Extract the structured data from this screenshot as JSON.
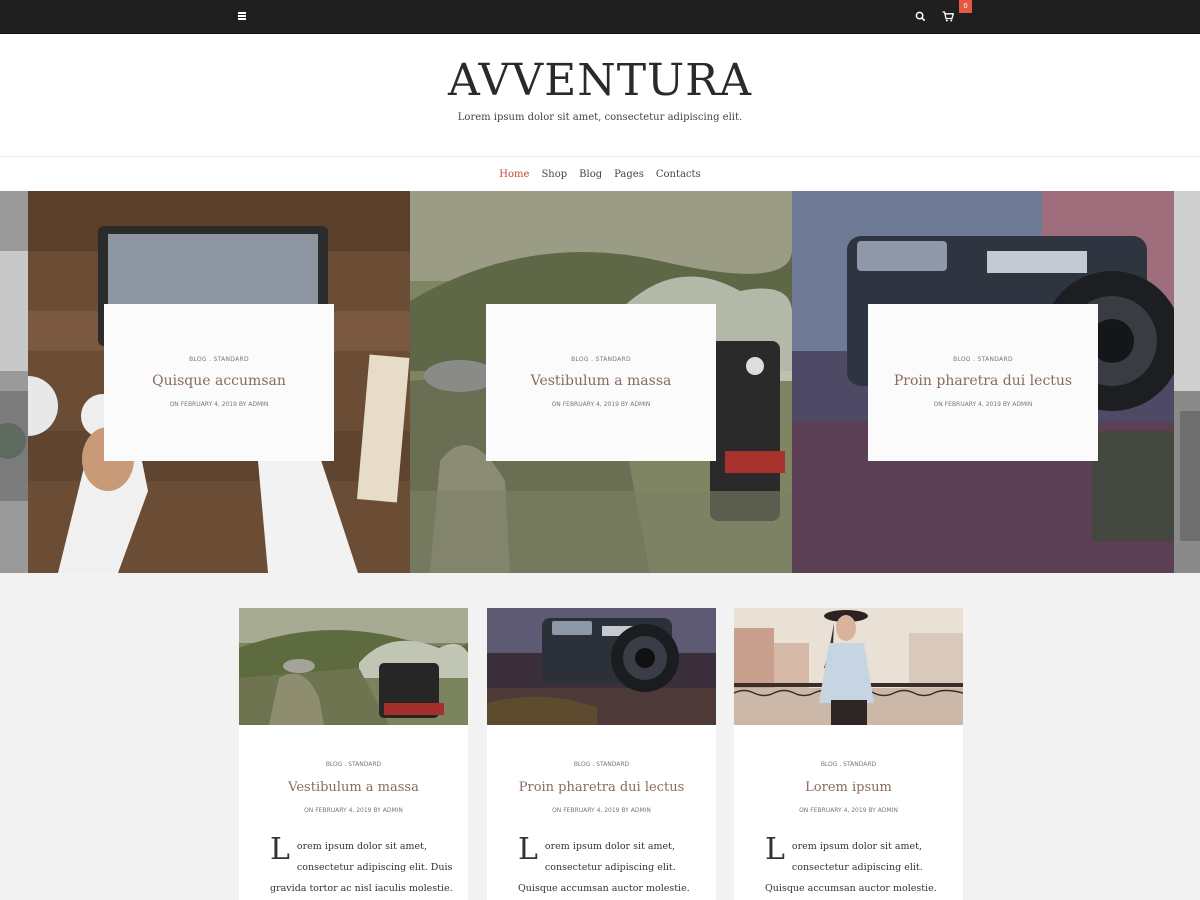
{
  "topbar": {
    "icons": [
      "menu-icon",
      "search-icon",
      "cart-icon"
    ],
    "cart_count": "0"
  },
  "header": {
    "logo": "AVVENTURA",
    "tagline": "Lorem ipsum dolor sit amet, consectetur adipiscing elit."
  },
  "nav": {
    "items": [
      "Home",
      "Shop",
      "Blog",
      "Pages",
      "Contacts"
    ],
    "active": "Home"
  },
  "slider": {
    "slides": [
      {
        "category": "BLOG . STANDARD",
        "title": "Quisque accumsan",
        "meta": "ON FEBRUARY 4, 2019 BY ADMIN"
      },
      {
        "category": "BLOG . STANDARD",
        "title": "Vestibulum a massa",
        "meta": "ON FEBRUARY 4, 2019 BY ADMIN"
      },
      {
        "category": "BLOG . STANDARD",
        "title": "Proin pharetra dui lectus",
        "meta": "ON FEBRUARY 4, 2019 BY ADMIN"
      }
    ]
  },
  "posts": [
    {
      "category": "BLOG . STANDARD",
      "title": "Vestibulum a massa",
      "meta": "ON FEBRUARY 4, 2019 BY ADMIN",
      "dropcap": "L",
      "excerpt": "orem ipsum dolor sit amet, consectetur adipiscing elit. Duis gravida tortor ac nisl iaculis molestie. Fusce pretium enim"
    },
    {
      "category": "BLOG . STANDARD",
      "title": "Proin pharetra dui lectus",
      "meta": "ON FEBRUARY 4, 2019 BY ADMIN",
      "dropcap": "L",
      "excerpt": "orem ipsum dolor sit amet, consectetur adipiscing elit. Quisque accumsan auctor molestie. Mauris faucibus magna"
    },
    {
      "category": "BLOG . STANDARD",
      "title": "Lorem ipsum",
      "meta": "ON FEBRUARY 4, 2019 BY ADMIN",
      "dropcap": "L",
      "excerpt": "orem ipsum dolor sit amet, consectetur adipiscing elit. Quisque accumsan auctor molestie. Mauris faucibus magna"
    }
  ],
  "colors": {
    "accent": "#c0492f",
    "title": "#8a6a5e",
    "badge": "#e8573f",
    "topbar": "#1f1f1f"
  }
}
